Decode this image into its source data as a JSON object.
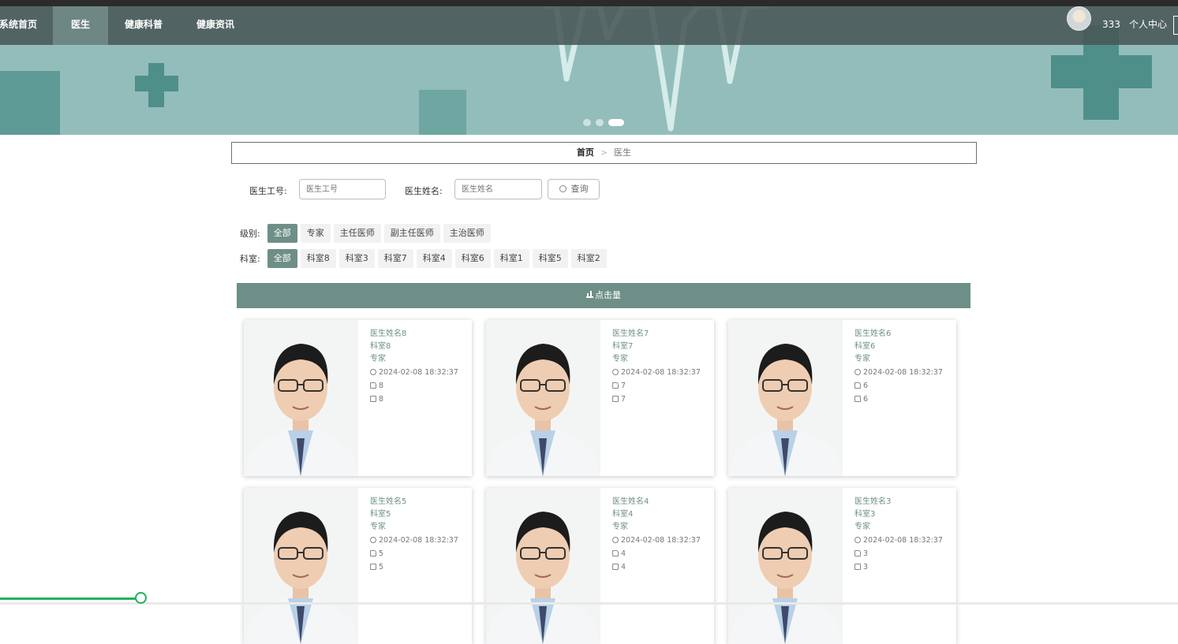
{
  "nav": {
    "items": [
      {
        "label": "系统首页",
        "active": false
      },
      {
        "label": "医生",
        "active": true
      },
      {
        "label": "健康科普",
        "active": false
      },
      {
        "label": "健康资讯",
        "active": false
      }
    ],
    "username": "333",
    "user_center": "个人中心"
  },
  "carousel": {
    "slide_count": 3,
    "active_index": 2
  },
  "breadcrumb": {
    "home": "首页",
    "separator": ">",
    "current": "医生"
  },
  "search": {
    "id_label": "医生工号:",
    "id_placeholder": "医生工号",
    "name_label": "医生姓名:",
    "name_placeholder": "医生姓名",
    "button": "查询"
  },
  "filters": {
    "level_label": "级别:",
    "levels": [
      "全部",
      "专家",
      "主任医师",
      "副主任医师",
      "主治医师"
    ],
    "level_active": 0,
    "dept_label": "科室:",
    "depts": [
      "全部",
      "科室8",
      "科室3",
      "科室7",
      "科室4",
      "科室6",
      "科室1",
      "科室5",
      "科室2"
    ],
    "dept_active": 0
  },
  "sort_bar": {
    "label": "点击量"
  },
  "doctors": [
    {
      "name": "医生姓名8",
      "dept": "科室8",
      "level": "专家",
      "time": "2024-02-08 18:32:37",
      "likes": "8",
      "comments": "8"
    },
    {
      "name": "医生姓名7",
      "dept": "科室7",
      "level": "专家",
      "time": "2024-02-08 18:32:37",
      "likes": "7",
      "comments": "7"
    },
    {
      "name": "医生姓名6",
      "dept": "科室6",
      "level": "专家",
      "time": "2024-02-08 18:32:37",
      "likes": "6",
      "comments": "6"
    },
    {
      "name": "医生姓名5",
      "dept": "科室5",
      "level": "专家",
      "time": "2024-02-08 18:32:37",
      "likes": "5",
      "comments": "5"
    },
    {
      "name": "医生姓名4",
      "dept": "科室4",
      "level": "专家",
      "time": "2024-02-08 18:32:37",
      "likes": "4",
      "comments": "4"
    },
    {
      "name": "医生姓名3",
      "dept": "科室3",
      "level": "专家",
      "time": "2024-02-08 18:32:37",
      "likes": "3",
      "comments": "3"
    }
  ],
  "colors": {
    "accent": "#6e8f88",
    "nav": "#485856",
    "banner": "#93bdbb",
    "progress": "#1fb35a"
  },
  "video_progress": 0.12
}
